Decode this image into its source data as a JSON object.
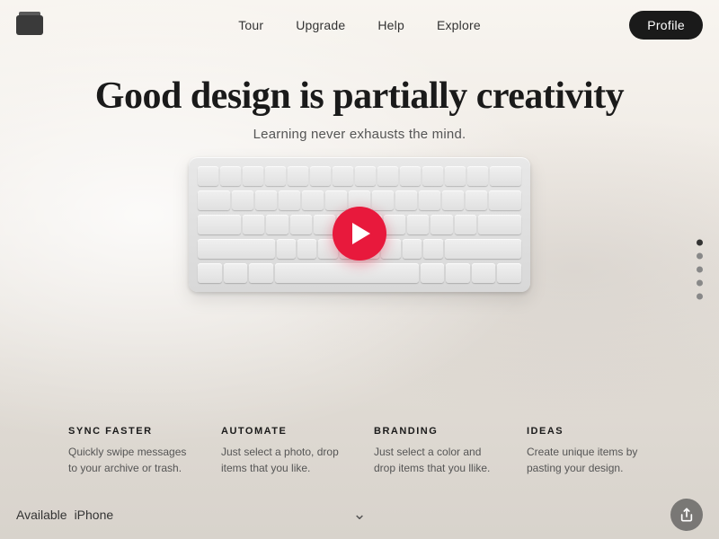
{
  "nav": {
    "links": [
      {
        "label": "Tour",
        "id": "tour"
      },
      {
        "label": "Upgrade",
        "id": "upgrade"
      },
      {
        "label": "Help",
        "id": "help"
      },
      {
        "label": "Explore",
        "id": "explore"
      }
    ],
    "profile_label": "Profile"
  },
  "hero": {
    "title": "Good design is partially creativity",
    "subtitle": "Learning never exhausts the mind."
  },
  "side_dots": [
    {
      "active": true
    },
    {
      "active": false
    },
    {
      "active": false
    },
    {
      "active": false
    },
    {
      "active": false
    }
  ],
  "features": [
    {
      "id": "sync-faster",
      "title": "SYNC FASTER",
      "desc": "Quickly swipe messages to your archive or trash."
    },
    {
      "id": "automate",
      "title": "AUTOMATE",
      "desc": "Just select a photo, drop items that you like."
    },
    {
      "id": "branding",
      "title": "BRANDING",
      "desc": "Just select a color and drop items that you llike."
    },
    {
      "id": "ideas",
      "title": "IDEAS",
      "desc": "Create unique items by pasting your design."
    }
  ],
  "footer": {
    "available_prefix": "Available",
    "available_platform": "iPhone"
  }
}
